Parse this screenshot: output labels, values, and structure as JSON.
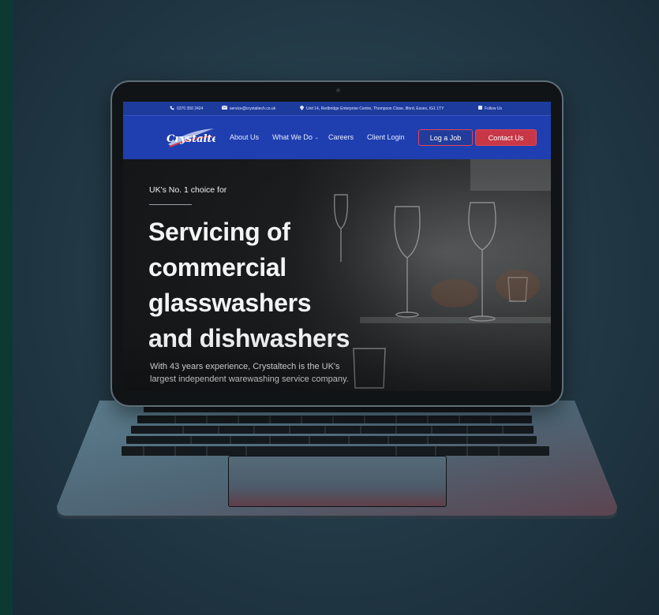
{
  "topbar": {
    "phone": "0370 350 2424",
    "email": "service@crystaltech.co.uk",
    "address": "Unit 14, Redbridge Enterprise Centre, Thompson Close, Ilford, Essex, IG1 1TY",
    "follow": "Follow Us"
  },
  "brand": {
    "name": "Crystaltech"
  },
  "nav": {
    "about": "About Us",
    "what": "What We Do",
    "careers": "Careers",
    "client_login": "Client Login",
    "log_job": "Log a Job",
    "contact": "Contact Us"
  },
  "hero": {
    "eyebrow": "UK's No. 1 choice for",
    "heading_line1": "Servicing of",
    "heading_line2": "commercial",
    "heading_line3": "glasswashers",
    "heading_line4": "and dishwashers",
    "description": "With 43 years experience, Crystaltech is the UK's largest independent warewashing service company."
  },
  "icons": {
    "phone": "phone-icon",
    "email": "envelope-icon",
    "address": "map-pin-icon",
    "social": "linkedin-icon",
    "dropdown": "chevron-down-icon"
  },
  "colors": {
    "topbar": "#1d3b9c",
    "navbar": "#1f3fb0",
    "accent": "#c93747",
    "background": "#0d3a34"
  }
}
